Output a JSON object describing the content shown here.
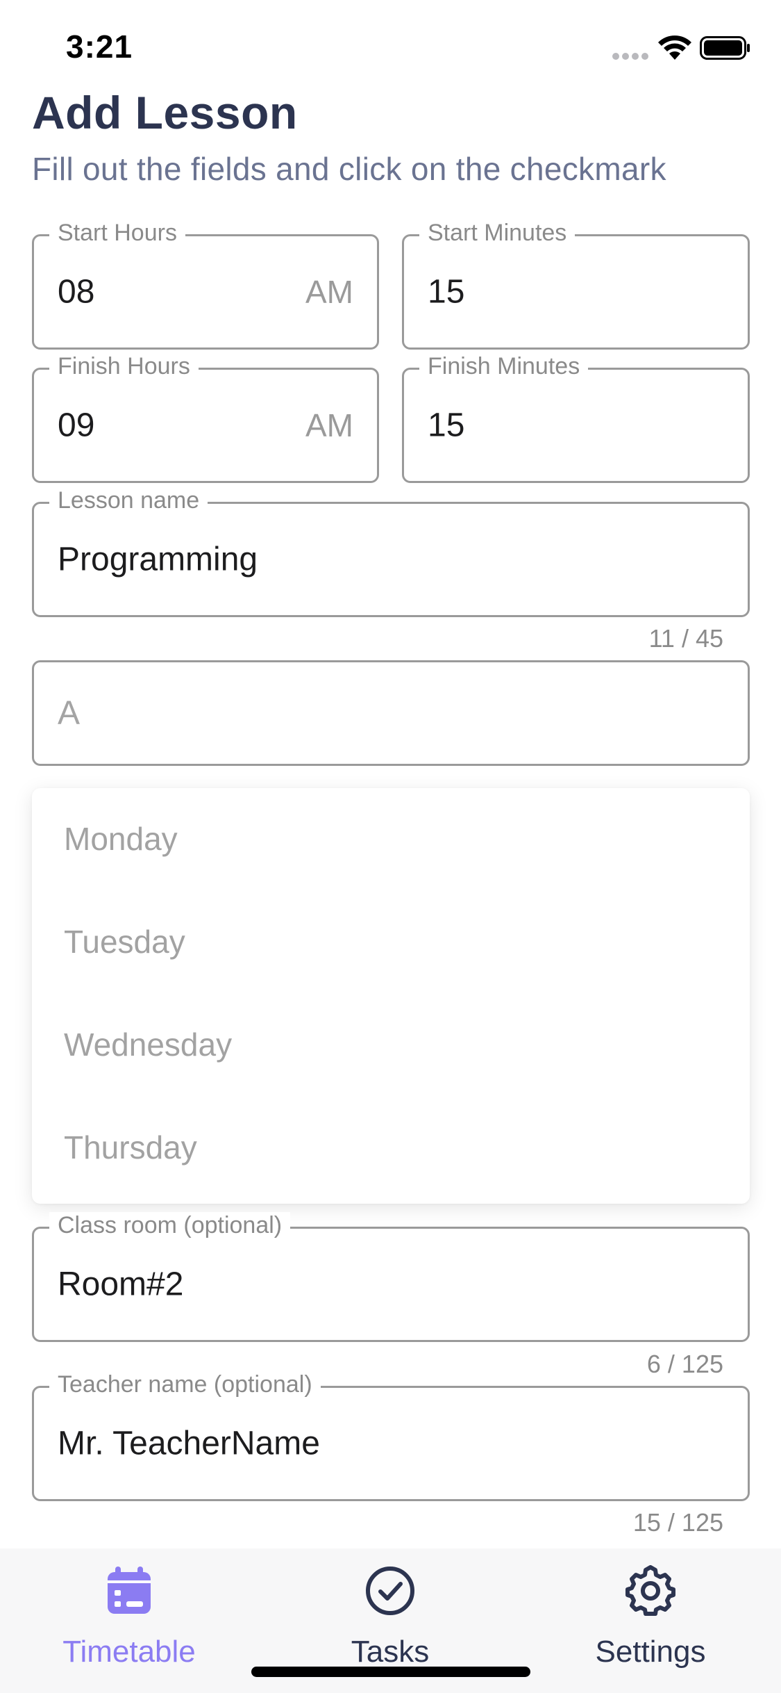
{
  "status_bar": {
    "time": "3:21"
  },
  "header": {
    "title": "Add Lesson",
    "subtitle": "Fill out the fields and click on the checkmark"
  },
  "form": {
    "start_hours": {
      "label": "Start Hours",
      "value": "08",
      "suffix": "AM"
    },
    "start_minutes": {
      "label": "Start Minutes",
      "value": "15"
    },
    "finish_hours": {
      "label": "Finish Hours",
      "value": "09",
      "suffix": "AM"
    },
    "finish_minutes": {
      "label": "Finish Minutes",
      "value": "15"
    },
    "lesson_name": {
      "label": "Lesson name",
      "value": "Programming",
      "counter": "11 / 45"
    },
    "day_select": {
      "value": "A"
    },
    "class_room": {
      "label": "Class room (optional)",
      "value": "Room#2",
      "counter": "6 / 125"
    },
    "teacher_name": {
      "label": "Teacher name (optional)",
      "value": "Mr. TeacherName",
      "counter": "15 / 125"
    }
  },
  "day_dropdown": {
    "items": [
      "Monday",
      "Tuesday",
      "Wednesday",
      "Thursday"
    ]
  },
  "tab_bar": {
    "tabs": [
      {
        "label": "Timetable",
        "icon": "calendar-icon",
        "active": true
      },
      {
        "label": "Tasks",
        "icon": "check-circle-icon",
        "active": false
      },
      {
        "label": "Settings",
        "icon": "gear-icon",
        "active": false
      }
    ]
  },
  "colors": {
    "title": "#2c3450",
    "subtitle": "#6a7391",
    "accent": "#8b7cf2",
    "field_border": "#9a9a9a",
    "inactive_tab": "#2c3450"
  }
}
